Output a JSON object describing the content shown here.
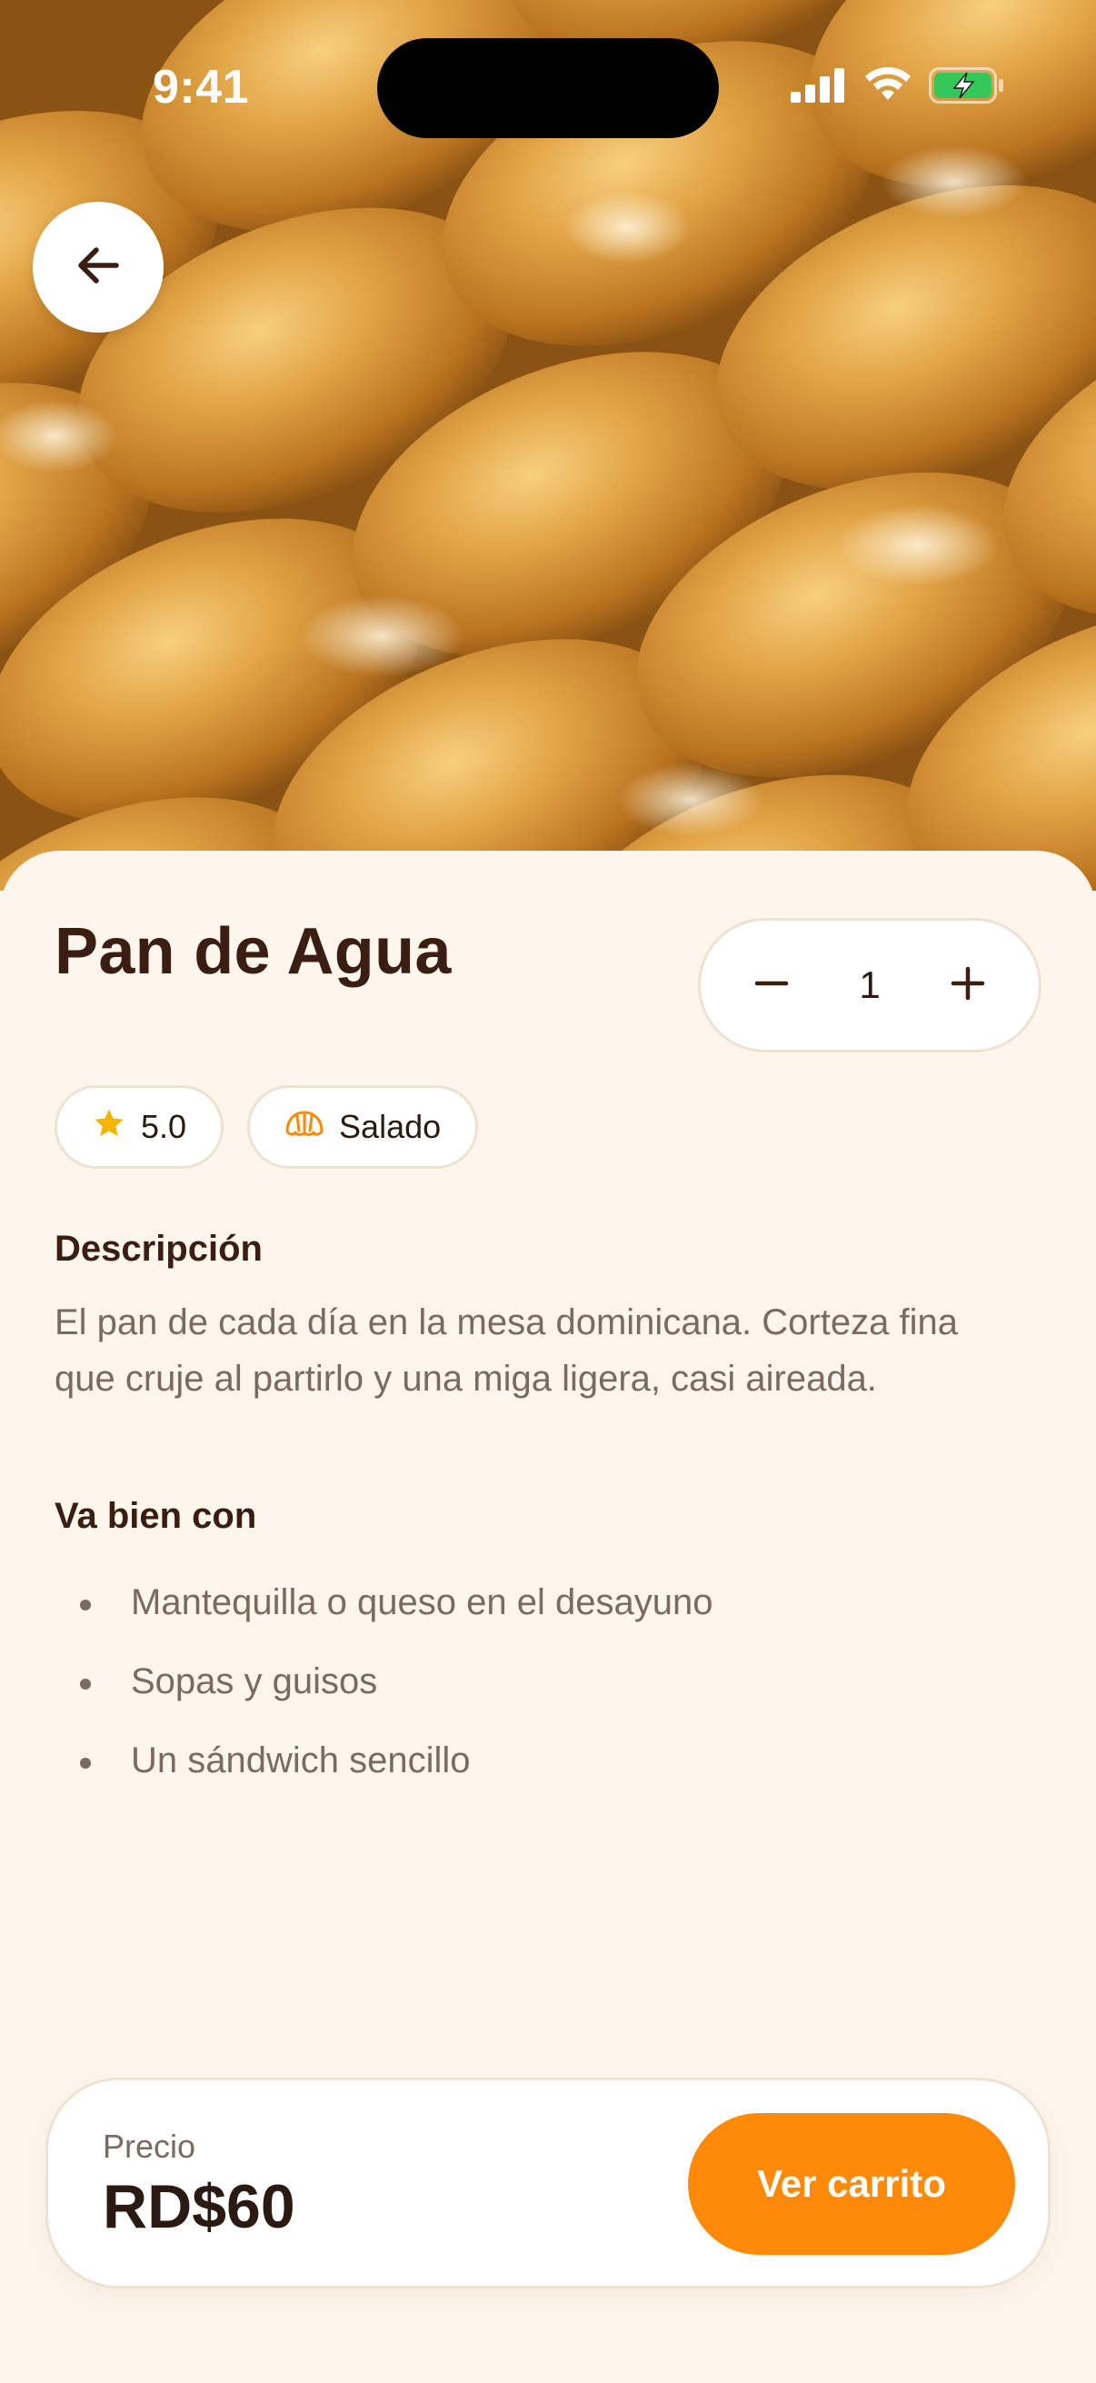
{
  "status_bar": {
    "time": "9:41"
  },
  "product": {
    "title": "Pan de Agua",
    "quantity": "1",
    "rating": "5.0",
    "category": "Salado"
  },
  "description": {
    "heading": "Descripción",
    "text": "El pan de cada día en la mesa dominicana. Corteza fina que cruje al partirlo y una miga ligera, casi aireada."
  },
  "pairings": {
    "heading": "Va bien con",
    "items": [
      "Mantequilla o queso en el desayuno",
      "Sopas y guisos",
      "Un sándwich sencillo"
    ]
  },
  "price_bar": {
    "label": "Precio",
    "value": "RD$60",
    "cart_button": "Ver carrito"
  },
  "colors": {
    "accent": "#FF8A0A",
    "background": "#FDF6EC",
    "title": "#3A1E12",
    "muted_text": "#7A6A5F",
    "star": "#F5B400",
    "battery": "#34C759"
  },
  "icons": {
    "back": "arrow-left-icon",
    "minus": "minus-icon",
    "plus": "plus-icon",
    "rating": "star-icon",
    "category": "croissant-icon"
  }
}
